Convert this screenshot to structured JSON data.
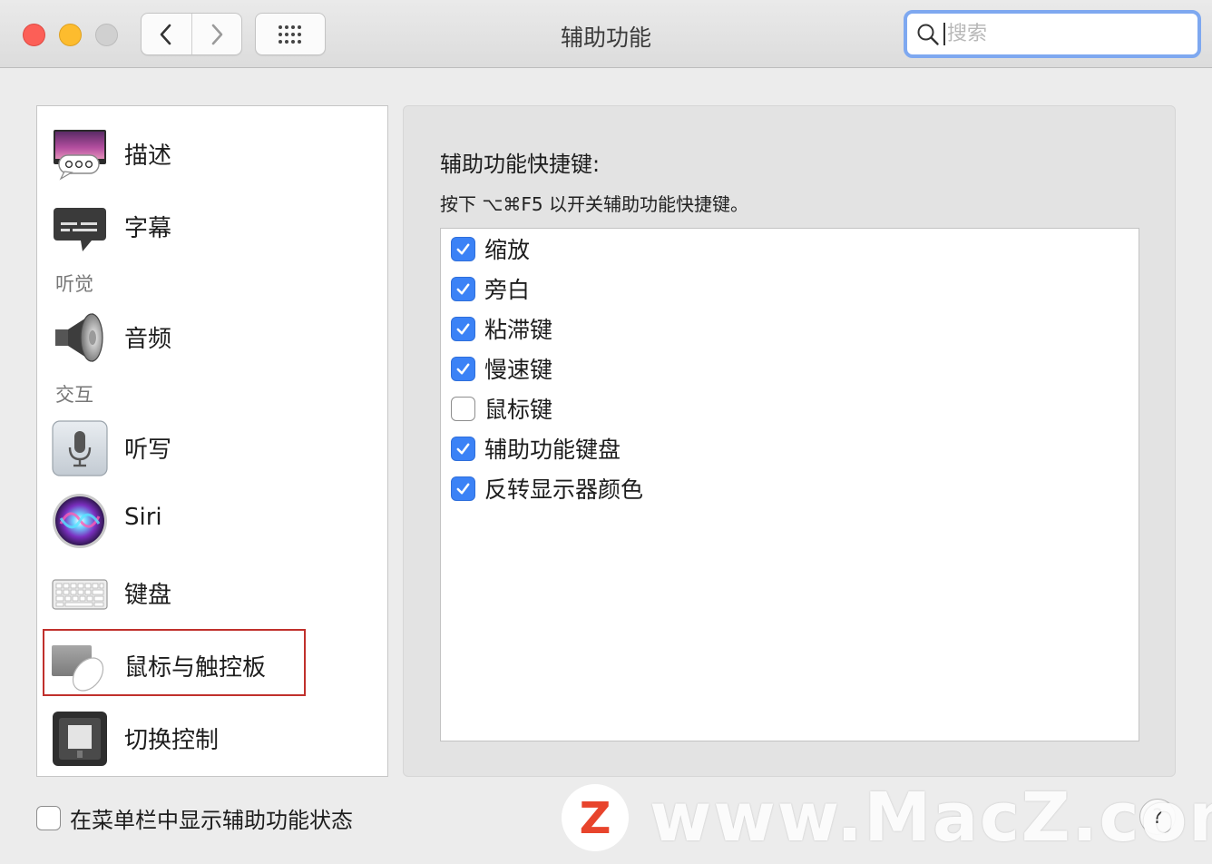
{
  "window": {
    "title": "辅助功能"
  },
  "search": {
    "placeholder": "搜索"
  },
  "sidebar": {
    "items": [
      {
        "label": "描述",
        "icon": "descriptions-icon"
      },
      {
        "label": "字幕",
        "icon": "captions-icon"
      },
      {
        "header": "听觉"
      },
      {
        "label": "音频",
        "icon": "speaker-icon"
      },
      {
        "header": "交互"
      },
      {
        "label": "听写",
        "icon": "microphone-icon"
      },
      {
        "label": "Siri",
        "icon": "siri-icon"
      },
      {
        "label": "键盘",
        "icon": "keyboard-icon"
      },
      {
        "label": "鼠标与触控板",
        "icon": "mouse-trackpad-icon",
        "selected": true
      },
      {
        "label": "切换控制",
        "icon": "switch-control-icon"
      }
    ]
  },
  "pane": {
    "title": "辅助功能快捷键:",
    "description": "按下 ⌥⌘F5 以开关辅助功能快捷键。",
    "options": [
      {
        "label": "缩放",
        "checked": true
      },
      {
        "label": "旁白",
        "checked": true
      },
      {
        "label": "粘滞键",
        "checked": true
      },
      {
        "label": "慢速键",
        "checked": true
      },
      {
        "label": "鼠标键",
        "checked": false
      },
      {
        "label": "辅助功能键盘",
        "checked": true
      },
      {
        "label": "反转显示器颜色",
        "checked": true
      }
    ]
  },
  "footer": {
    "show_status_label": "在菜单栏中显示辅助功能状态",
    "show_status_checked": false,
    "help_label": "?"
  },
  "watermark": {
    "text": "www.MacZ.com",
    "logo_letter": "Z"
  },
  "colors": {
    "accent": "#3b82f6",
    "selection_border": "#c0302c",
    "close": "#fc5f57",
    "minimize": "#fdbc2e"
  }
}
